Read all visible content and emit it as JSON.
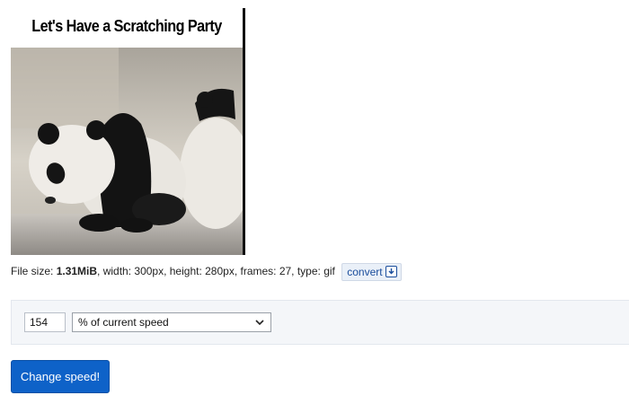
{
  "gif": {
    "caption": "Let's Have a Scratching Party"
  },
  "file_info": {
    "size_label": "File size: ",
    "size_value": "1.31MiB",
    "details": ", width: 300px, height: 280px, frames: 27, type: gif",
    "convert_label": "convert"
  },
  "speed_form": {
    "value": "154",
    "unit_selected": "% of current speed",
    "submit_label": "Change speed!"
  },
  "colors": {
    "primary_button": "#0e62c8",
    "link": "#1a4d9c"
  }
}
